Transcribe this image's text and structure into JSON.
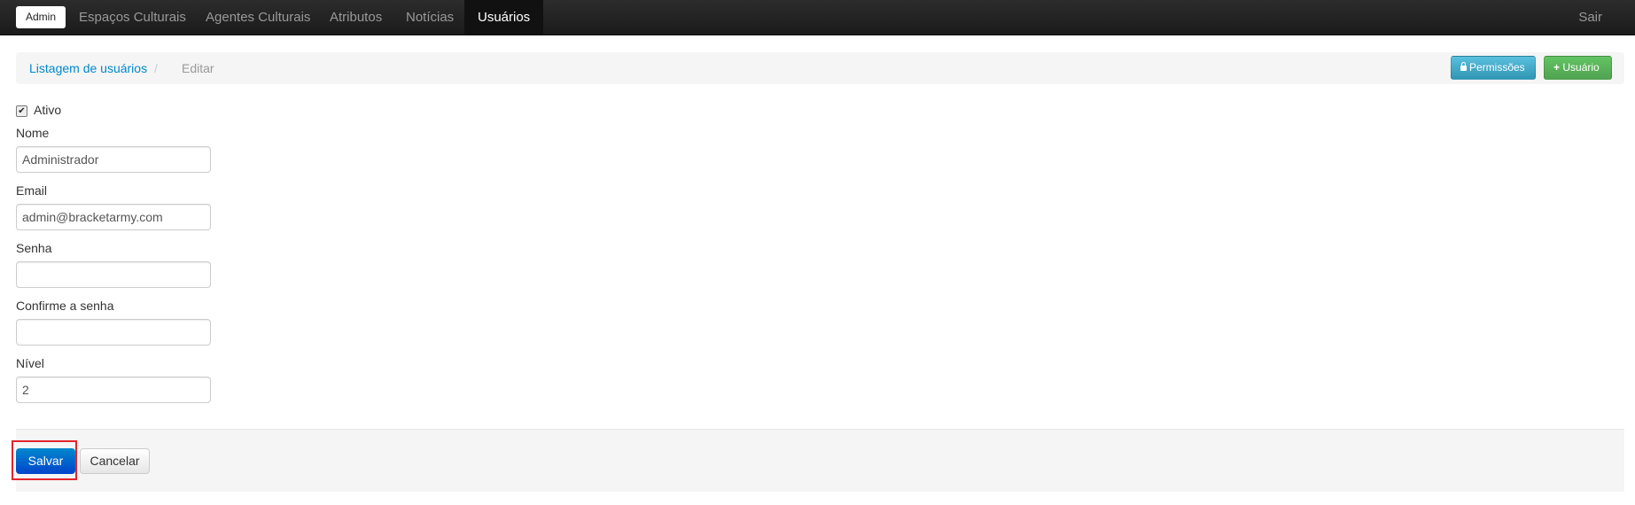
{
  "navbar": {
    "brand": "Admin",
    "items": [
      "Espaços Culturais",
      "Agentes Culturais",
      "Atributos",
      "Notícias",
      "Usuários"
    ],
    "active": "Usuários",
    "logout": "Sair"
  },
  "breadcrumb": {
    "link": "Listagem de usuários",
    "separator": "/",
    "current": "Editar"
  },
  "actions": {
    "permissions_label": "Permissões",
    "add_user_label": "Usuário"
  },
  "form": {
    "active_label": "Ativo",
    "active_checked": true,
    "fields": [
      {
        "label": "Nome",
        "value": "Administrador"
      },
      {
        "label": "Email",
        "value": "admin@bracketarmy.com"
      },
      {
        "label": "Senha",
        "value": ""
      },
      {
        "label": "Confirme a senha",
        "value": ""
      },
      {
        "label": "Nível",
        "value": "2"
      }
    ],
    "save_label": "Salvar",
    "cancel_label": "Cancelar"
  },
  "colors": {
    "navbar": "#1b1b1b",
    "link": "#0088cc",
    "primary": "#0044cc",
    "info": "#2f96b4",
    "success": "#51a351",
    "highlight": "#e3242b"
  }
}
